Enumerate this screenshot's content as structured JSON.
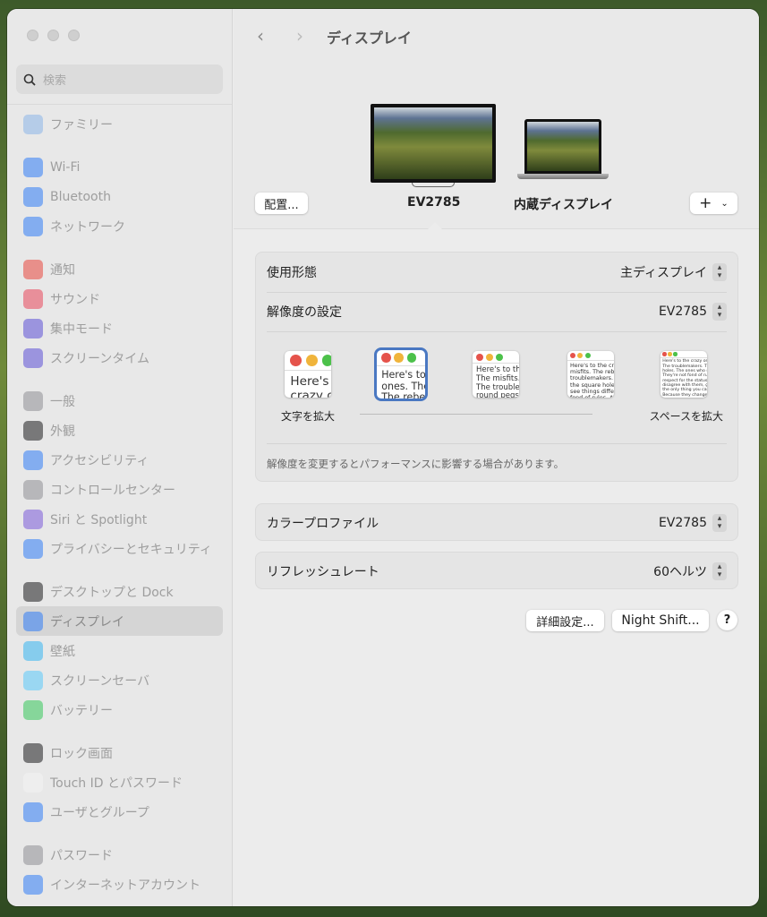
{
  "window": {
    "title": "ディスプレイ"
  },
  "sidebar": {
    "search_placeholder": "検索",
    "groups": [
      [
        {
          "label": "ファミリー",
          "icon": "family-icon",
          "color": "#8ab4e8"
        }
      ],
      [
        {
          "label": "Wi-Fi",
          "icon": "wifi-icon",
          "color": "#2f7cf6"
        },
        {
          "label": "Bluetooth",
          "icon": "bluetooth-icon",
          "color": "#2f7cf6"
        },
        {
          "label": "ネットワーク",
          "icon": "globe-icon",
          "color": "#2f7cf6"
        }
      ],
      [
        {
          "label": "通知",
          "icon": "bell-icon",
          "color": "#e8453c"
        },
        {
          "label": "サウンド",
          "icon": "speaker-icon",
          "color": "#e8455a"
        },
        {
          "label": "集中モード",
          "icon": "moon-icon",
          "color": "#5b4fd6"
        },
        {
          "label": "スクリーンタイム",
          "icon": "hourglass-icon",
          "color": "#5b4fd6"
        }
      ],
      [
        {
          "label": "一般",
          "icon": "gear-icon",
          "color": "#8e8e93"
        },
        {
          "label": "外観",
          "icon": "appearance-icon",
          "color": "#1c1c1e"
        },
        {
          "label": "アクセシビリティ",
          "icon": "accessibility-icon",
          "color": "#2f7cf6"
        },
        {
          "label": "コントロールセンター",
          "icon": "control-center-icon",
          "color": "#8e8e93"
        },
        {
          "label": "Siri と Spotlight",
          "icon": "siri-icon",
          "color": "#7a5ad8"
        },
        {
          "label": "プライバシーとセキュリティ",
          "icon": "hand-icon",
          "color": "#2f7cf6"
        }
      ],
      [
        {
          "label": "デスクトップと Dock",
          "icon": "dock-icon",
          "color": "#1c1c1e"
        },
        {
          "label": "ディスプレイ",
          "icon": "display-icon",
          "color": "#2f7cf6",
          "selected": true
        },
        {
          "label": "壁紙",
          "icon": "wallpaper-icon",
          "color": "#35b5f0"
        },
        {
          "label": "スクリーンセーバ",
          "icon": "screensaver-icon",
          "color": "#5ac8fa"
        },
        {
          "label": "バッテリー",
          "icon": "battery-icon",
          "color": "#34c759"
        }
      ],
      [
        {
          "label": "ロック画面",
          "icon": "lock-icon",
          "color": "#1c1c1e"
        },
        {
          "label": "Touch ID とパスワード",
          "icon": "fingerprint-icon",
          "color": "#f2f2f2"
        },
        {
          "label": "ユーザとグループ",
          "icon": "users-icon",
          "color": "#2f7cf6"
        }
      ],
      [
        {
          "label": "パスワード",
          "icon": "key-icon",
          "color": "#8e8e93"
        },
        {
          "label": "インターネットアカウント",
          "icon": "at-icon",
          "color": "#2f7cf6"
        }
      ]
    ]
  },
  "header": {
    "title": "ディスプレイ",
    "arrange_button": "配置...",
    "add_button": "+"
  },
  "displays": [
    {
      "name": "EV2785",
      "selected": true
    },
    {
      "name": "内蔵ディスプレイ"
    }
  ],
  "settings": {
    "use_as": {
      "label": "使用形態",
      "value": "主ディスプレイ"
    },
    "resolution": {
      "label": "解像度の設定",
      "value": "EV2785",
      "left_label": "文字を拡大",
      "right_label": "スペースを拡大",
      "selected_index": 1,
      "note": "解像度を変更するとパフォーマンスに影響する場合があります。",
      "sample_text": "Here's to the crazy ones. The misfits. The rebels. The troublemakers. The round pegs in the square holes. The ones who see things differently. They're not fond of rules. And they have no respect for the status quo. You can quote them, disagree with them, glorify or vilify them. About the only thing you can't do is ignore them. Because they change things."
    },
    "color_profile": {
      "label": "カラープロファイル",
      "value": "EV2785"
    },
    "refresh_rate": {
      "label": "リフレッシュレート",
      "value": "60ヘルツ"
    }
  },
  "footer": {
    "advanced": "詳細設定...",
    "night_shift": "Night Shift...",
    "help": "?"
  }
}
